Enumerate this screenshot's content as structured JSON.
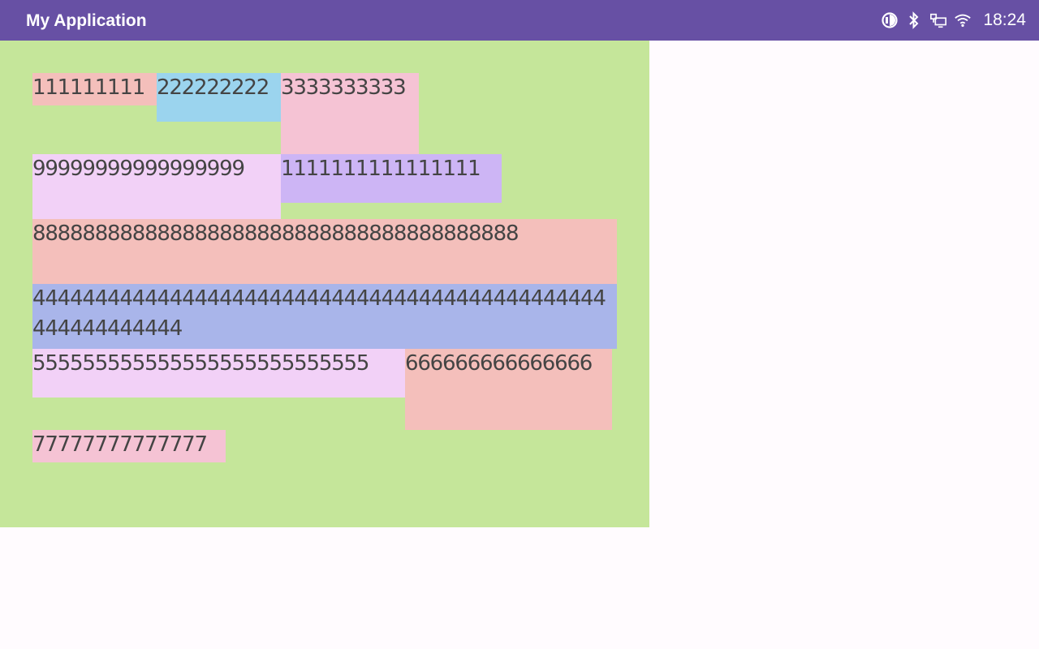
{
  "app_bar": {
    "title": "My Application",
    "background": "#6750a4"
  },
  "status_bar": {
    "icons": [
      "data-saver-icon",
      "bluetooth-icon",
      "ethernet-icon",
      "wifi-icon"
    ],
    "time": "18:24"
  },
  "content": {
    "background": "#c5e69a",
    "items": [
      {
        "id": "item-1a",
        "text": "111111111",
        "color": "#f4bfbb"
      },
      {
        "id": "item-2",
        "text": "222222222",
        "color": "#9bd4ee"
      },
      {
        "id": "item-3",
        "text": "3333333333",
        "color": "#f5c3d4"
      },
      {
        "id": "item-9",
        "text": "99999999999999999",
        "color": "#f2d1f7"
      },
      {
        "id": "item-1b",
        "text": "1111111111111111",
        "color": "#cdb5f5"
      },
      {
        "id": "item-8",
        "text": "888888888888888888888888888888888888888",
        "color": "#f4bfbb"
      },
      {
        "id": "item-4",
        "text": "4444444444444444444444444444444444444444444444444444444444",
        "color": "#a9b5ea"
      },
      {
        "id": "item-5",
        "text": "555555555555555555555555555",
        "color": "#f2d1f7"
      },
      {
        "id": "item-6",
        "text": "666666666666666",
        "color": "#f4bfbb"
      },
      {
        "id": "item-7",
        "text": "77777777777777",
        "color": "#f5c3d4"
      }
    ]
  }
}
